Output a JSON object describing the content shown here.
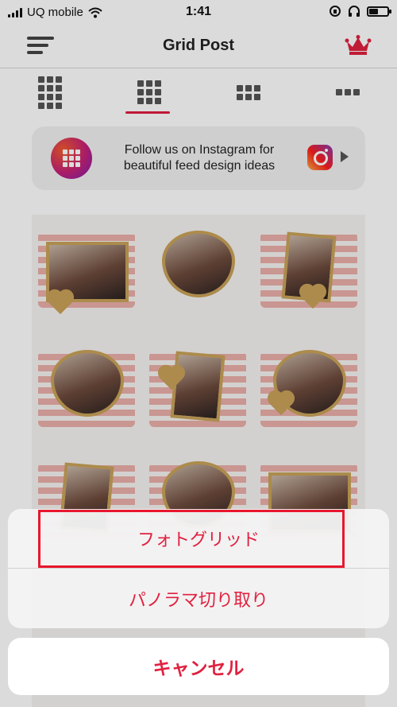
{
  "status_bar": {
    "carrier": "UQ mobile",
    "time": "1:41",
    "battery_level": 0.5
  },
  "nav": {
    "title": "Grid Post",
    "menu_icon": "hamburger-icon",
    "premium_icon": "crown-icon"
  },
  "grid_tabs": [
    {
      "name": "grid-4x4",
      "rows": 4,
      "cols": 4,
      "active": false
    },
    {
      "name": "grid-3x3",
      "rows": 3,
      "cols": 3,
      "active": true
    },
    {
      "name": "grid-3x2",
      "rows": 2,
      "cols": 3,
      "active": false
    },
    {
      "name": "grid-3x1",
      "rows": 1,
      "cols": 3,
      "active": false
    }
  ],
  "promo": {
    "text_line1": "Follow us on Instagram for",
    "text_line2": "beautiful feed design ideas",
    "icon": "instagram-icon"
  },
  "action_sheet": {
    "option1": "フォトグリッド",
    "option2": "パノラマ切り取り",
    "cancel": "キャンセル"
  },
  "colors": {
    "accent": "#e0213f",
    "highlight": "#e8172e",
    "gold": "#c9a259",
    "stripe": "#e8a39c"
  }
}
